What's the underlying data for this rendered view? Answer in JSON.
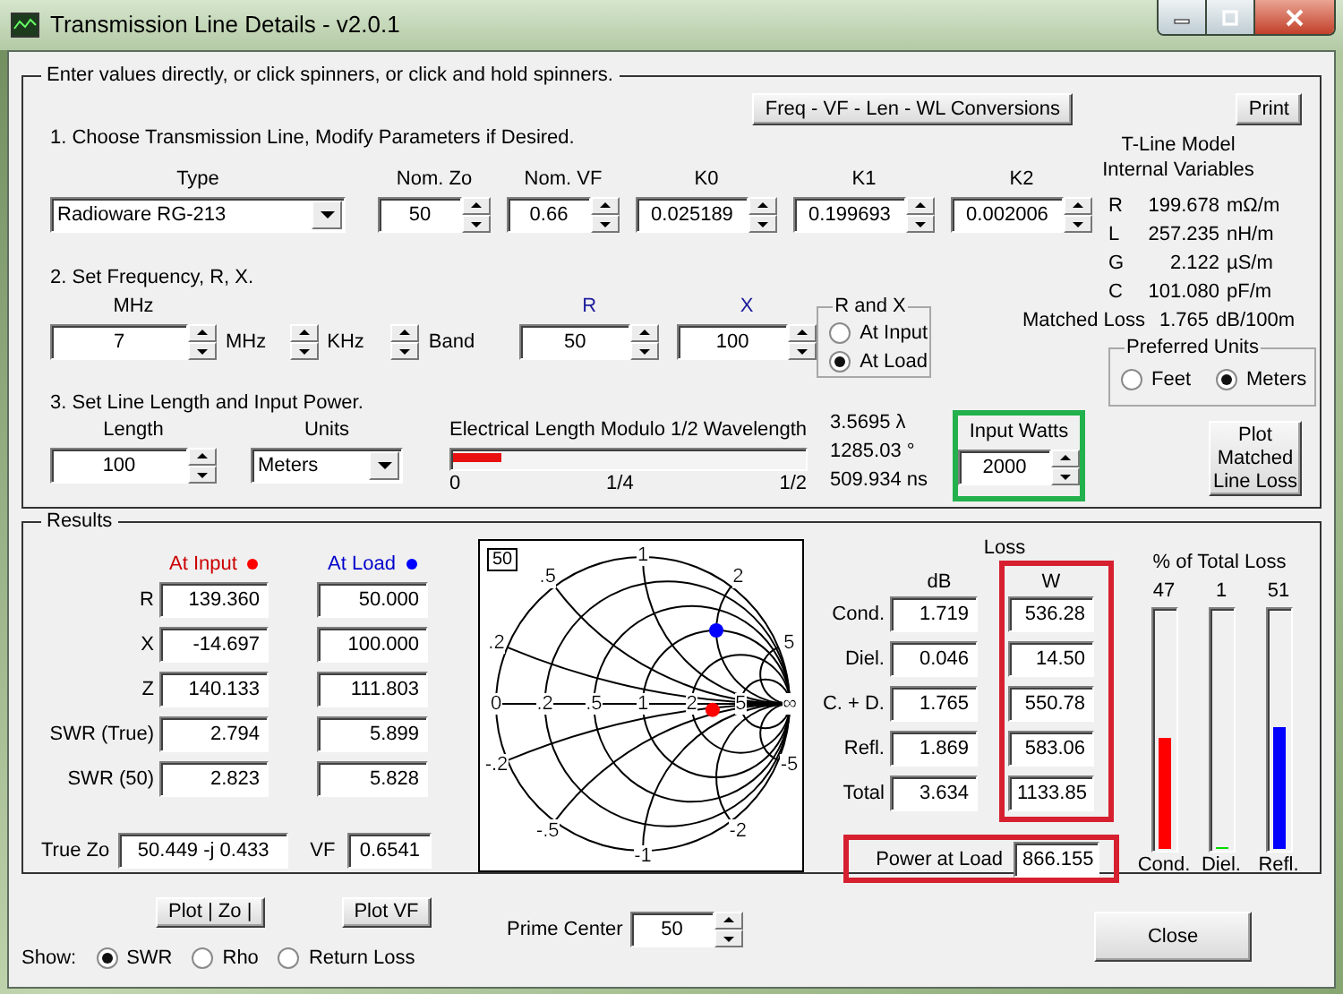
{
  "window": {
    "title": "Transmission Line Details - v2.0.1"
  },
  "input_group": {
    "legend": "Enter values directly, or click spinners, or click and hold spinners.",
    "conversions_button": "Freq - VF - Len - WL Conversions",
    "print_button": "Print",
    "step_1": {
      "heading": "1. Choose Transmission Line, Modify Parameters if Desired.",
      "type": {
        "label": "Type",
        "value": "Radioware RG-213"
      },
      "parameters": [
        {
          "label": "Nom. Zo",
          "value": "50"
        },
        {
          "label": "Nom. VF",
          "value": "0.66"
        },
        {
          "label": "K0",
          "value": "0.025189"
        },
        {
          "label": "K1",
          "value": "0.199693"
        },
        {
          "label": "K2",
          "value": "0.002006"
        }
      ]
    },
    "step_2": {
      "heading": "2. Set Frequency, R, X.",
      "frequency": {
        "label": "MHz",
        "value": "7",
        "unit": "MHz"
      },
      "khz_spinner": "KHz",
      "band_spinner": "Band",
      "r": {
        "label": "R",
        "value": "50"
      },
      "x": {
        "label": "X",
        "value": "100"
      },
      "r_and_x": {
        "title": "R and X",
        "options": [
          {
            "label": "At Input",
            "selected": false
          },
          {
            "label": "At Load",
            "selected": true
          }
        ]
      }
    },
    "step_3": {
      "heading": "3. Set Line Length and Input Power.",
      "length": {
        "label": "Length",
        "value": "100"
      },
      "units": {
        "label": "Units",
        "value": "Meters"
      },
      "electrical_length": {
        "title": "Electrical Length Modulo 1/2 Wavelength",
        "level": 0.14,
        "ticks": [
          "0",
          "1/4",
          "1/2"
        ],
        "readings": [
          "3.5695 λ",
          "1285.03 °",
          "509.934 ns"
        ]
      },
      "input_watts": {
        "label": "Input Watts",
        "value": "2000"
      }
    },
    "tline_model": {
      "title": [
        "T-Line Model",
        "Internal Variables"
      ],
      "rows": [
        {
          "name": "R",
          "value": "199.678",
          "unit": "mΩ/m"
        },
        {
          "name": "L",
          "value": "257.235",
          "unit": "nH/m"
        },
        {
          "name": "G",
          "value": "2.122",
          "unit": "µS/m"
        },
        {
          "name": "C",
          "value": "101.080",
          "unit": "pF/m"
        }
      ],
      "matched_loss": {
        "label": "Matched Loss",
        "value": "1.765",
        "unit": "dB/100m"
      }
    },
    "preferred_units": {
      "title": "Preferred Units",
      "options": [
        {
          "label": "Feet",
          "selected": false
        },
        {
          "label": "Meters",
          "selected": true
        }
      ]
    },
    "plot_matched_button": "Plot Matched Line Loss"
  },
  "results": {
    "legend": "Results",
    "columns": [
      {
        "label": "At Input",
        "color": "#ff0000"
      },
      {
        "label": "At Load",
        "color": "#0000ff"
      }
    ],
    "rows": [
      {
        "label": "R",
        "values": [
          "139.360",
          "50.000"
        ]
      },
      {
        "label": "X",
        "values": [
          "-14.697",
          "100.000"
        ]
      },
      {
        "label": "Z",
        "values": [
          "140.133",
          "111.803"
        ]
      },
      {
        "label": "SWR (True)",
        "values": [
          "2.794",
          "5.899"
        ]
      },
      {
        "label": "SWR (50)",
        "values": [
          "2.823",
          "5.828"
        ]
      }
    ],
    "true_zo": {
      "label": "True Zo",
      "value": "50.449 -j 0.433"
    },
    "vf": {
      "label": "VF",
      "value": "0.6541"
    },
    "smith_chart": {
      "impedance": "50",
      "axis_labels": [
        "0",
        ".2",
        ".5",
        "1",
        "2",
        "5",
        "∞"
      ],
      "upper_labels": [
        ".2",
        ".5",
        "1",
        "2",
        "5"
      ],
      "lower_labels": [
        "-.2",
        "-.5",
        "-1",
        "-2",
        "-5"
      ]
    },
    "loss": {
      "title": "Loss",
      "db_header": "dB",
      "w_header": "W",
      "rows": [
        {
          "label": "Cond.",
          "db": "1.719",
          "w": "536.28"
        },
        {
          "label": "Diel.",
          "db": "0.046",
          "w": "14.50"
        },
        {
          "label": "C. + D.",
          "db": "1.765",
          "w": "550.78"
        },
        {
          "label": "Refl.",
          "db": "1.869",
          "w": "583.06"
        },
        {
          "label": "Total",
          "db": "3.634",
          "w": "1133.85"
        }
      ],
      "power_at_load": {
        "label": "Power at Load",
        "value": "866.155"
      }
    },
    "loss_share": {
      "title": "% of Total Loss",
      "bars": [
        {
          "label": "Cond.",
          "percent": "47",
          "level": 0.47,
          "color": "#ff0000"
        },
        {
          "label": "Diel.",
          "percent": "1",
          "level": 0.01,
          "color": "#00dd00"
        },
        {
          "label": "Refl.",
          "percent": "51",
          "level": 0.51,
          "color": "#0000ff"
        }
      ]
    }
  },
  "footer": {
    "plot_zo_button": "Plot | Zo |",
    "plot_vf_button": "Plot VF",
    "show": {
      "label": "Show:",
      "options": [
        {
          "label": "SWR",
          "selected": true
        },
        {
          "label": "Rho",
          "selected": false
        },
        {
          "label": "Return Loss",
          "selected": false
        }
      ]
    },
    "prime_center": {
      "label": "Prime Center",
      "value": "50"
    },
    "close_button": "Close"
  }
}
